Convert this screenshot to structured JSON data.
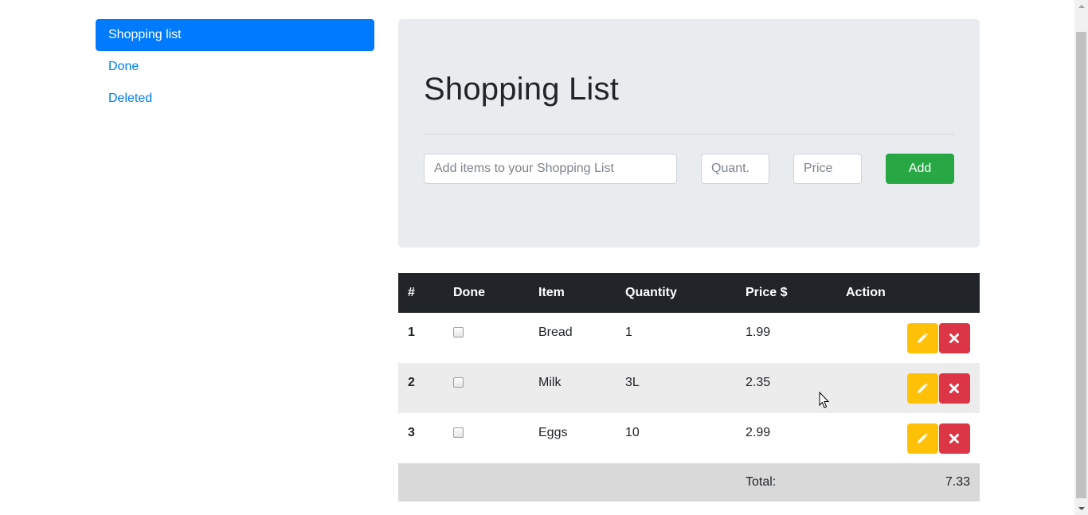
{
  "sidebar": {
    "items": [
      {
        "label": "Shopping list",
        "active": true
      },
      {
        "label": "Done",
        "active": false
      },
      {
        "label": "Deleted",
        "active": false
      }
    ]
  },
  "header": {
    "title": "Shopping List"
  },
  "form": {
    "item_placeholder": "Add items to your Shopping List",
    "quantity_placeholder": "Quant.",
    "price_placeholder": "Price",
    "add_label": "Add"
  },
  "table": {
    "headers": [
      "#",
      "Done",
      "Item",
      "Quantity",
      "Price $",
      "Action"
    ],
    "rows": [
      {
        "num": "1",
        "done": false,
        "item": "Bread",
        "quantity": "1",
        "price": "1.99"
      },
      {
        "num": "2",
        "done": false,
        "item": "Milk",
        "quantity": "3L",
        "price": "2.35"
      },
      {
        "num": "3",
        "done": false,
        "item": "Eggs",
        "quantity": "10",
        "price": "2.99"
      }
    ],
    "total_label": "Total:",
    "total_value": "7.33"
  },
  "icons": {
    "edit": "pencil-icon",
    "delete": "times-icon"
  },
  "colors": {
    "primary": "#007bff",
    "success": "#28a745",
    "warning": "#ffc107",
    "danger": "#dc3545",
    "dark": "#212529"
  }
}
